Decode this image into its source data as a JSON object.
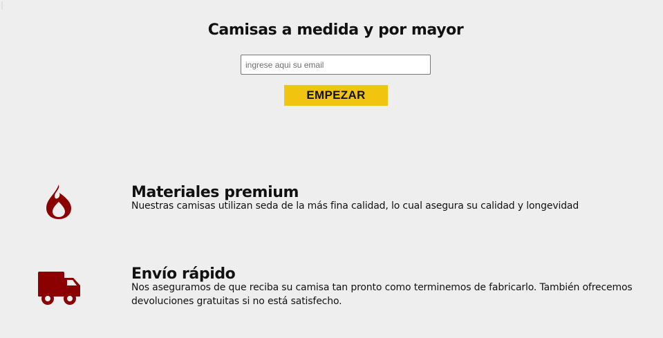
{
  "hero": {
    "title": "Camisas a medida y por mayor",
    "email_placeholder": "ingrese aqui su email",
    "email_value": "",
    "start_label": "EMPEZAR"
  },
  "features": [
    {
      "icon": "fire-icon",
      "title": "Materiales premium",
      "description": "Nuestras camisas utilizan seda de la más fina calidad, lo cual asegura su calidad y longevidad"
    },
    {
      "icon": "truck-icon",
      "title": "Envío rápido",
      "description": "Nos aseguramos de que reciba su camisa tan pronto como terminemos de fabricarlo. También ofrecemos devoluciones gratuitas si no está satisfecho."
    }
  ],
  "colors": {
    "background": "#eeeeee",
    "button": "#f1c40f",
    "icon": "#8b0000",
    "text": "#111111"
  }
}
